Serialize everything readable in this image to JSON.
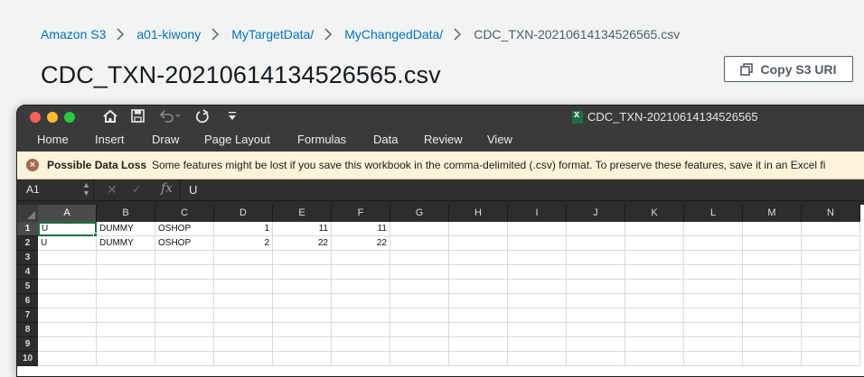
{
  "breadcrumb": {
    "items": [
      "Amazon S3",
      "a01-kiwony",
      "MyTargetData/",
      "MyChangedData/"
    ],
    "current": "CDC_TXN-20210614134526565.csv"
  },
  "page_title": "CDC_TXN-20210614134526565.csv",
  "copy_uri_label": "Copy S3 URI",
  "excel": {
    "window_title": "CDC_TXN-20210614134526565",
    "tabs": [
      "Home",
      "Insert",
      "Draw",
      "Page Layout",
      "Formulas",
      "Data",
      "Review",
      "View"
    ],
    "message": {
      "title": "Possible Data Loss",
      "text": "Some features might be lost if you save this workbook in the comma-delimited (.csv) format. To preserve these features, save it in an Excel fi"
    },
    "name_box": "A1",
    "formula": "U",
    "columns": [
      "A",
      "B",
      "C",
      "D",
      "E",
      "F",
      "G",
      "H",
      "I",
      "J",
      "K",
      "L",
      "M",
      "N"
    ],
    "row_numbers": [
      "1",
      "2",
      "3",
      "4",
      "5",
      "6",
      "7",
      "8",
      "9",
      "10"
    ],
    "rows": [
      [
        "U",
        "DUMMY",
        "OSHOP",
        "1",
        "11",
        "11"
      ],
      [
        "U",
        "DUMMY",
        "OSHOP",
        "2",
        "22",
        "22"
      ]
    ],
    "selected_cell": "A1"
  },
  "icons": {
    "home": "home-icon",
    "save": "save-icon",
    "undo": "undo-icon",
    "redo": "redo-icon",
    "customize": "customize-toolbar-icon",
    "copy": "copy-icon",
    "warning": "warning-icon"
  }
}
